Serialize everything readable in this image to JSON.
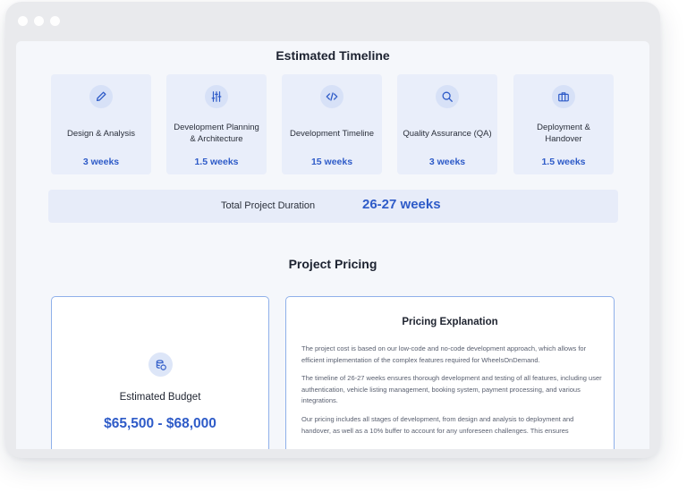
{
  "timeline": {
    "title": "Estimated Timeline",
    "phases": [
      {
        "label": "Design & Analysis",
        "duration": "3 weeks",
        "icon": "pen-icon"
      },
      {
        "label": "Development Planning & Architecture",
        "duration": "1.5 weeks",
        "icon": "sliders-icon"
      },
      {
        "label": "Development Timeline",
        "duration": "15 weeks",
        "icon": "code-icon"
      },
      {
        "label": "Quality Assurance (QA)",
        "duration": "3 weeks",
        "icon": "search-icon"
      },
      {
        "label": "Deployment & Handover",
        "duration": "1.5 weeks",
        "icon": "briefcase-icon"
      }
    ],
    "total_label": "Total Project Duration",
    "total_value": "26-27 weeks"
  },
  "pricing": {
    "title": "Project Pricing",
    "budget_label": "Estimated Budget",
    "budget_value": "$65,500 - $68,000",
    "budget_icon": "coins-icon",
    "explanation_title": "Pricing Explanation",
    "paragraphs": [
      "The project cost is based on our low-code and no-code development approach, which allows for efficient implementation of the complex features required for WheelsOnDemand.",
      "The timeline of 26-27 weeks ensures thorough development and testing of all features, including user authentication, vehicle listing management, booking system, payment processing, and various integrations.",
      "Our pricing includes all stages of development, from design and analysis to deployment and handover, as well as a 10% buffer to account for any unforeseen challenges. This ensures"
    ]
  },
  "colors": {
    "accent": "#2e5bc8",
    "card_bg": "#e9eefa",
    "border": "#8fb0ea"
  }
}
